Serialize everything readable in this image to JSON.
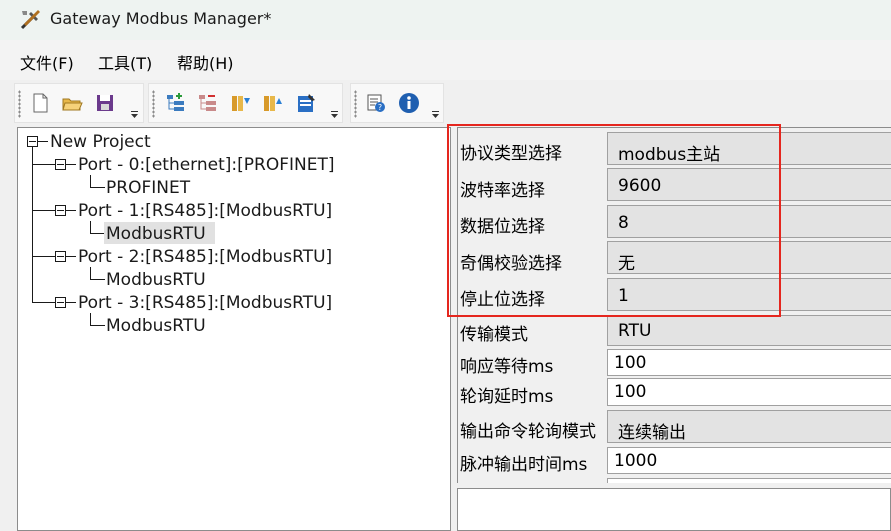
{
  "window": {
    "title": "Gateway Modbus Manager*",
    "app_icon": "tools-icon"
  },
  "menu": [
    {
      "label": "文件(F)"
    },
    {
      "label": "工具(T)"
    },
    {
      "label": "帮助(H)"
    }
  ],
  "toolbars": [
    {
      "icons": [
        "new-file-icon",
        "open-folder-icon",
        "save-icon"
      ]
    },
    {
      "icons": [
        "add-node-icon",
        "remove-node-icon",
        "import-icon",
        "export-icon",
        "edit-icon"
      ]
    },
    {
      "icons": [
        "settings-help-icon",
        "info-icon"
      ]
    }
  ],
  "tree": {
    "root": "New Project",
    "ports": [
      {
        "label": "Port - 0:[ethernet]:[PROFINET]",
        "child": "PROFINET",
        "selected": false
      },
      {
        "label": "Port - 1:[RS485]:[ModbusRTU]",
        "child": "ModbusRTU",
        "selected": true
      },
      {
        "label": "Port - 2:[RS485]:[ModbusRTU]",
        "child": "ModbusRTU",
        "selected": false
      },
      {
        "label": "Port - 3:[RS485]:[ModbusRTU]",
        "child": "ModbusRTU",
        "selected": false
      }
    ]
  },
  "properties": [
    {
      "label": "协议类型选择",
      "value": "modbus主站",
      "kind": "dropdown"
    },
    {
      "label": "波特率选择",
      "value": "9600",
      "kind": "dropdown"
    },
    {
      "label": "数据位选择",
      "value": "8",
      "kind": "dropdown"
    },
    {
      "label": "奇偶校验选择",
      "value": "无",
      "kind": "dropdown"
    },
    {
      "label": "停止位选择",
      "value": "1",
      "kind": "dropdown"
    },
    {
      "label": "传输模式",
      "value": "RTU",
      "kind": "dropdown"
    },
    {
      "label": "响应等待ms",
      "value": "100",
      "kind": "text"
    },
    {
      "label": "轮询延时ms",
      "value": "100",
      "kind": "text"
    },
    {
      "label": "输出命令轮询模式",
      "value": "连续输出",
      "kind": "dropdown"
    },
    {
      "label": "脉冲输出时间ms",
      "value": "1000",
      "kind": "text"
    }
  ],
  "colors": {
    "highlight_box": "#e5261e",
    "selection": "#e1e1e1"
  }
}
